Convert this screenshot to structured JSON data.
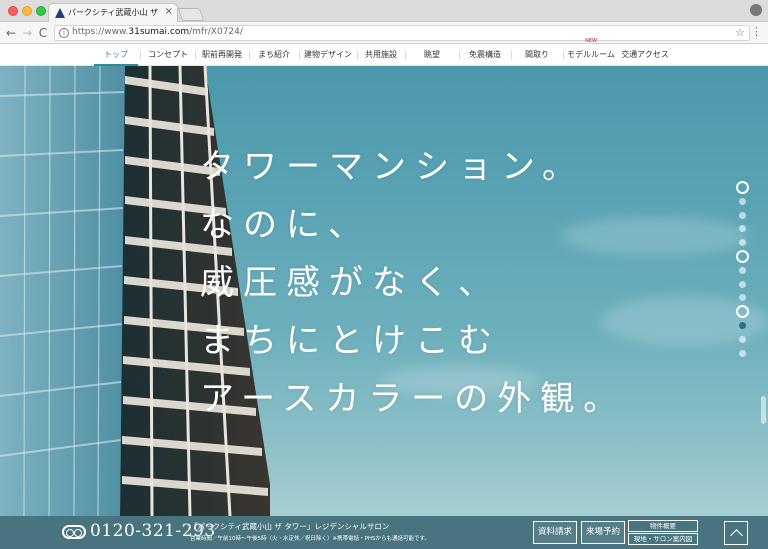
{
  "browser": {
    "tab_title": "パークシティ武蔵小山 ザ タワー",
    "tab_close": "×",
    "url_prefix": "https://www.",
    "url_host": "31sumai.com",
    "url_path": "/mfr/X0724/",
    "info_icon": "i",
    "star": "☆",
    "menu": "⋮",
    "back": "←",
    "forward": "→",
    "reload": "C"
  },
  "nav": {
    "items": [
      {
        "label": "トップ",
        "active": true
      },
      {
        "label": "コンセプト"
      },
      {
        "label": "駅前再開発"
      },
      {
        "label": "まち紹介"
      },
      {
        "label": "建物デザイン"
      },
      {
        "label": "共用施設"
      },
      {
        "label": "眺望"
      },
      {
        "label": "免震構造"
      },
      {
        "label": "間取り"
      },
      {
        "label": "モデルルーム",
        "badge": "NEW"
      },
      {
        "label": "交通アクセス"
      }
    ]
  },
  "hero": {
    "lines": [
      "タワーマンション。",
      "なのに、",
      "威圧感がなく、",
      "まちにとけこむ",
      "アースカラーの外観。"
    ]
  },
  "pager": {
    "dots": [
      "ring",
      "dot",
      "dot",
      "dot",
      "dot",
      "ring",
      "dot",
      "dot",
      "dot",
      "ring",
      "current",
      "dot",
      "dot"
    ]
  },
  "footer": {
    "phone": "0120-321-293",
    "salon": "「パークシティ武蔵小山 ザ タワー」レジデンシャルサロン",
    "hours": "営業時間／午前10時〜午後5時（火・水定休／祝日除く）※携帯電話・PHSからも通話可能です。",
    "btn_request": "資料請求",
    "btn_visit": "来場予約",
    "btn_overview": "物件概要",
    "btn_map": "現地・サロン案内図"
  },
  "colors": {
    "accent": "#2f8a9c",
    "footer_bg": "#386874",
    "new_badge": "#d0223a"
  }
}
